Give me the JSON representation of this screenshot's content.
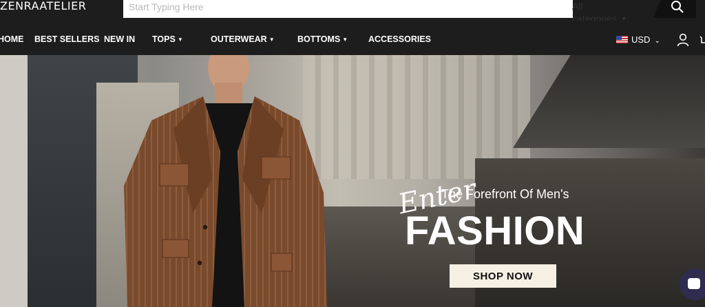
{
  "brand": {
    "logo": "ZENRAATELIER"
  },
  "search": {
    "placeholder": "Start Typing Here",
    "category_label": "All categories",
    "button_icon": "search-icon"
  },
  "nav": {
    "items": [
      {
        "label": "HOME",
        "dropdown": false
      },
      {
        "label": "BEST SELLERS",
        "dropdown": false
      },
      {
        "label": "NEW IN",
        "dropdown": false
      },
      {
        "label": "TOPS",
        "dropdown": true
      },
      {
        "label": "OUTERWEAR",
        "dropdown": true
      },
      {
        "label": "BOTTOMS",
        "dropdown": true
      },
      {
        "label": "ACCESSORIES",
        "dropdown": false
      }
    ],
    "currency": "USD",
    "currency_icon": "us-flag-icon",
    "account_icon": "user-icon",
    "cart_icon": "cart-icon"
  },
  "hero": {
    "script_word": "Enter",
    "tagline": "The Forefront Of Men's",
    "headline": "FASHION",
    "cta_label": "SHOP NOW"
  },
  "chat": {
    "icon": "chat-icon"
  },
  "colors": {
    "nav_bg": "#1d1d1d",
    "cta_bg": "#f6efe4",
    "chat_bg": "#2e2c4f"
  }
}
